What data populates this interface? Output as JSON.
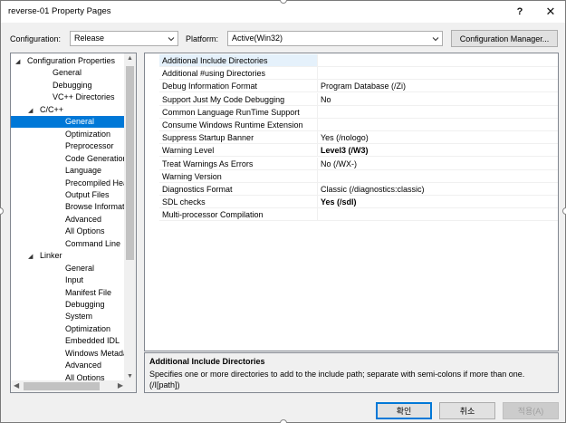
{
  "window": {
    "title": "reverse-01 Property Pages",
    "help_label": "?",
    "close_label": "✕"
  },
  "config": {
    "configuration_label": "Configuration:",
    "configuration_value": "Release",
    "platform_label": "Platform:",
    "platform_value": "Active(Win32)",
    "manager_button": "Configuration Manager..."
  },
  "tree": {
    "items": [
      {
        "label": "Configuration Properties",
        "expander": "◢"
      },
      {
        "label": "General"
      },
      {
        "label": "Debugging"
      },
      {
        "label": "VC++ Directories"
      },
      {
        "label": "C/C++",
        "expander": "◢"
      },
      {
        "label": "General",
        "selected": true
      },
      {
        "label": "Optimization"
      },
      {
        "label": "Preprocessor"
      },
      {
        "label": "Code Generation"
      },
      {
        "label": "Language"
      },
      {
        "label": "Precompiled Headers"
      },
      {
        "label": "Output Files"
      },
      {
        "label": "Browse Information"
      },
      {
        "label": "Advanced"
      },
      {
        "label": "All Options"
      },
      {
        "label": "Command Line"
      },
      {
        "label": "Linker",
        "expander": "◢"
      },
      {
        "label": "General"
      },
      {
        "label": "Input"
      },
      {
        "label": "Manifest File"
      },
      {
        "label": "Debugging"
      },
      {
        "label": "System"
      },
      {
        "label": "Optimization"
      },
      {
        "label": "Embedded IDL"
      },
      {
        "label": "Windows Metadata"
      },
      {
        "label": "Advanced"
      },
      {
        "label": "All Options"
      }
    ]
  },
  "properties": [
    {
      "name": "Additional Include Directories",
      "value": ""
    },
    {
      "name": "Additional #using Directories",
      "value": ""
    },
    {
      "name": "Debug Information Format",
      "value": "Program Database (/Zi)"
    },
    {
      "name": "Support Just My Code Debugging",
      "value": "No"
    },
    {
      "name": "Common Language RunTime Support",
      "value": ""
    },
    {
      "name": "Consume Windows Runtime Extension",
      "value": ""
    },
    {
      "name": "Suppress Startup Banner",
      "value": "Yes (/nologo)"
    },
    {
      "name": "Warning Level",
      "value": "Level3 (/W3)",
      "bold": true
    },
    {
      "name": "Treat Warnings As Errors",
      "value": "No (/WX-)"
    },
    {
      "name": "Warning Version",
      "value": ""
    },
    {
      "name": "Diagnostics Format",
      "value": "Classic (/diagnostics:classic)"
    },
    {
      "name": "SDL checks",
      "value": "Yes (/sdl)",
      "bold": true
    },
    {
      "name": "Multi-processor Compilation",
      "value": ""
    }
  ],
  "description": {
    "title": "Additional Include Directories",
    "text": "Specifies one or more directories to add to the include path; separate with semi-colons if more than one. (/I[path])"
  },
  "buttons": {
    "ok": "확인",
    "cancel": "취소",
    "apply": "적용(A)"
  }
}
